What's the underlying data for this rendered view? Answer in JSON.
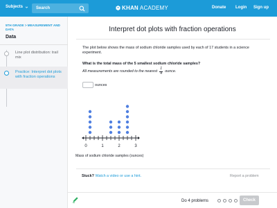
{
  "nav": {
    "subjects_label": "Subjects",
    "search_placeholder": "Search",
    "logo_bold": "KHAN",
    "logo_light": "ACADEMY",
    "donate": "Donate",
    "login": "Login",
    "signup": "Sign up"
  },
  "sidebar": {
    "breadcrumb": "5TH GRADE  > MEASUREMENT AND DATA",
    "unit_title": "Data",
    "items": [
      {
        "label": "Line plot distribution: trail mix"
      },
      {
        "label": "Practice: Interpret dot plots with fraction operations"
      }
    ]
  },
  "main": {
    "title": "Interpret dot plots with fraction operations",
    "intro": "The plot below shows the mass of sodium chloride samples used by each of 17 students in a science experiment.",
    "question": "What is the total mass of the 5 smallest sodium chloride samples?",
    "note_prefix": "All measurements are rounded to the nearest",
    "note_frac_num": "1",
    "note_frac_den": "4",
    "note_suffix": "ounce.",
    "answer_value": "",
    "answer_unit": "ounces",
    "plot_caption": "Mass of sodium chloride samples (ounces)",
    "stuck_q": "Stuck?",
    "stuck_link": "Watch a video or use a hint.",
    "report": "Report a problem"
  },
  "footer": {
    "do_problems": "Do 4 problems",
    "check": "Check"
  },
  "colors": {
    "brand": "#1c9bd8",
    "dot": "#4f7fe0",
    "pencil": "#2fb163"
  },
  "chart_data": {
    "type": "scatter",
    "title": "",
    "xlabel": "Mass of sodium chloride samples (ounces)",
    "ticks": [
      "0",
      "1",
      "2",
      "3"
    ],
    "xlim": [
      0,
      3
    ],
    "tick_step": 0.25,
    "points": [
      {
        "x": 0.25,
        "count": 5
      },
      {
        "x": 1.5,
        "count": 3
      },
      {
        "x": 2.0,
        "count": 3
      },
      {
        "x": 2.5,
        "count": 6
      }
    ]
  }
}
